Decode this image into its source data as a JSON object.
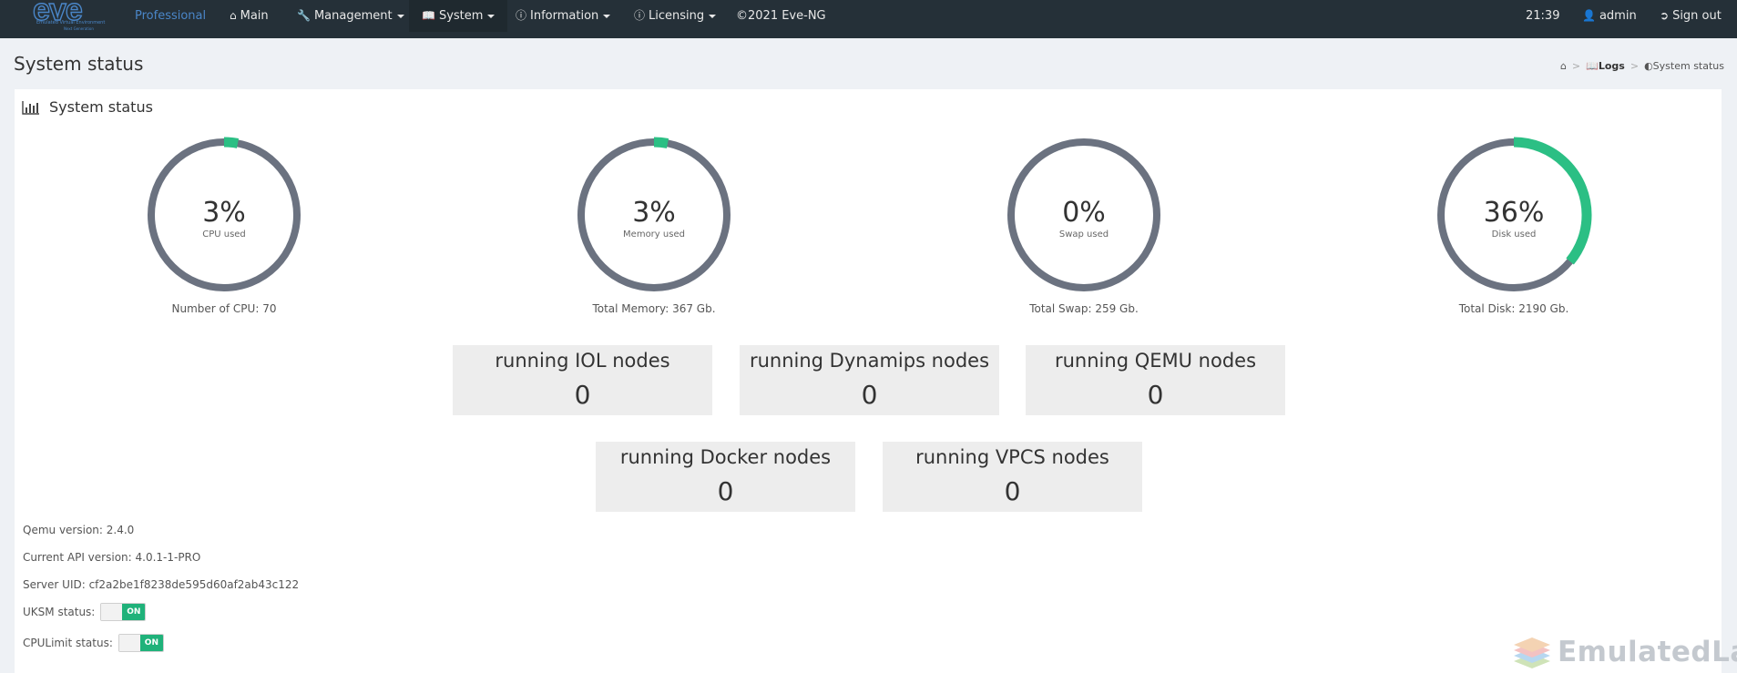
{
  "navbar": {
    "brand_text": "eve",
    "brand_sub": "Emulated Virtual Environment",
    "brand_sub2": "Next Generation",
    "edition": "Professional",
    "menu": [
      {
        "label": "Main",
        "icon": "home-icon",
        "dropdown": false
      },
      {
        "label": "Management",
        "icon": "wrench-icon",
        "dropdown": true
      },
      {
        "label": "System",
        "icon": "book-icon",
        "dropdown": true
      },
      {
        "label": "Information",
        "icon": "info-circle-icon",
        "dropdown": true
      },
      {
        "label": "Licensing",
        "icon": "info-circle-icon",
        "dropdown": true
      }
    ],
    "copyright": "©2021 Eve-NG",
    "time": "21:39",
    "user": "admin",
    "signout": "Sign out",
    "bg_color": "#253038",
    "accent_color": "#4a86c8"
  },
  "page": {
    "title": "System status",
    "breadcrumb": {
      "home_icon": "home-icon",
      "logs": "Logs",
      "current": "System status"
    }
  },
  "panel": {
    "title": "System status",
    "title_icon": "bar-chart-icon"
  },
  "gauges": [
    {
      "value_text": "3%",
      "label": "CPU used",
      "percent": 3,
      "total": "Number of CPU: 70"
    },
    {
      "value_text": "3%",
      "label": "Memory used",
      "percent": 3,
      "total": "Total Memory: 367 Gb."
    },
    {
      "value_text": "0%",
      "label": "Swap used",
      "percent": 0,
      "total": "Total Swap: 259 Gb."
    },
    {
      "value_text": "36%",
      "label": "Disk used",
      "percent": 36,
      "total": "Total Disk: 2190 Gb."
    }
  ],
  "gauge_colors": {
    "track": "#6b7280",
    "fill": "#2bbf84"
  },
  "nodes": [
    {
      "label": "running IOL nodes",
      "count": "0"
    },
    {
      "label": "running Dynamips nodes",
      "count": "0"
    },
    {
      "label": "running QEMU nodes",
      "count": "0"
    },
    {
      "label": "running Docker nodes",
      "count": "0"
    },
    {
      "label": "running VPCS nodes",
      "count": "0"
    }
  ],
  "info": {
    "qemu": "Qemu version: 2.4.0",
    "api": "Current API version: 4.0.1-1-PRO",
    "uid": "Server UID: cf2a2be1f8238de595d60af2ab43c122",
    "uksm_label": "UKSM status:",
    "uksm_state": "ON",
    "cpulimit_label": "CPULimit status:",
    "cpulimit_state": "ON"
  },
  "watermark": "EmulatedLab"
}
